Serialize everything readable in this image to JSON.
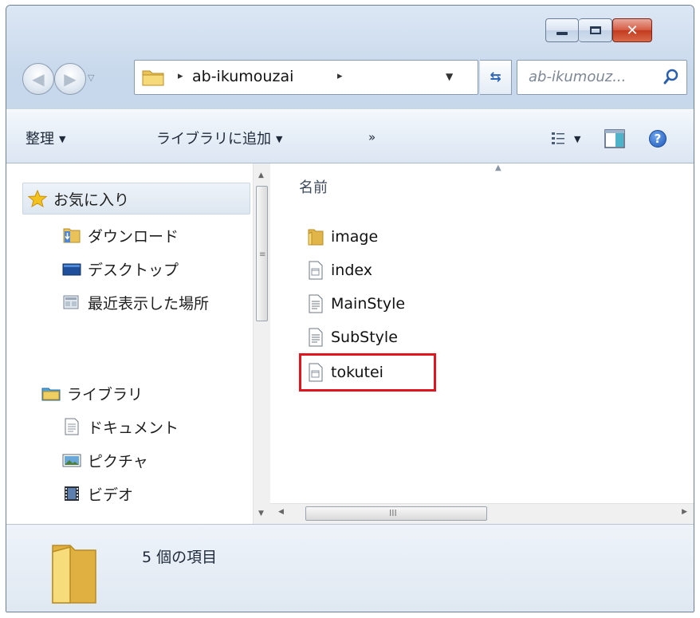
{
  "window": {
    "controls": {
      "minimize_icon": "minimize-icon",
      "maximize_icon": "maximize-icon",
      "close_icon": "close-icon",
      "close_glyph": "✕"
    }
  },
  "navbar": {
    "back_icon": "back-arrow-icon",
    "forward_icon": "forward-arrow-icon",
    "back_glyph": "◀",
    "forward_glyph": "▶",
    "history_dropdown_glyph": "▽",
    "address": {
      "folder_icon": "folder-icon",
      "separator": "▸",
      "breadcrumb": "ab-ikumouzai",
      "dropdown_glyph": "▼"
    },
    "refresh_glyph": "⇆",
    "search": {
      "placeholder": "ab-ikumouz...",
      "icon": "search-icon"
    }
  },
  "toolbar": {
    "organize_label": "整理",
    "add_to_library_label": "ライブラリに追加",
    "more_label": "»",
    "dropdown_glyph": "▼",
    "view_icon": "view-options-icon",
    "preview_pane_icon": "preview-pane-icon",
    "help_label": "?"
  },
  "nav_pane": {
    "favorites": {
      "label": "お気に入り",
      "icon": "star-icon"
    },
    "favorite_items": [
      {
        "label": "ダウンロード",
        "icon": "downloads-folder-icon"
      },
      {
        "label": "デスクトップ",
        "icon": "desktop-icon"
      },
      {
        "label": "最近表示した場所",
        "icon": "recent-places-icon"
      }
    ],
    "libraries": {
      "label": "ライブラリ",
      "icon": "library-icon"
    },
    "library_items": [
      {
        "label": "ドキュメント",
        "icon": "documents-icon"
      },
      {
        "label": "ピクチャ",
        "icon": "pictures-icon"
      },
      {
        "label": "ビデオ",
        "icon": "videos-icon"
      }
    ]
  },
  "content": {
    "column_header": "名前",
    "files": [
      {
        "name": "image",
        "icon": "folder-icon"
      },
      {
        "name": "index",
        "icon": "html-file-icon"
      },
      {
        "name": "MainStyle",
        "icon": "text-file-icon"
      },
      {
        "name": "SubStyle",
        "icon": "text-file-icon"
      },
      {
        "name": "tokutei",
        "icon": "html-file-icon",
        "highlighted": true
      }
    ],
    "highlight_color": "#e2141d"
  },
  "scrollbars": {
    "up": "▲",
    "down": "▼",
    "left": "◀",
    "right": "▶",
    "grip_h": "III",
    "grip_v": "≡"
  },
  "status": {
    "item_count": "5 個の項目",
    "icon": "folder-large-icon"
  }
}
